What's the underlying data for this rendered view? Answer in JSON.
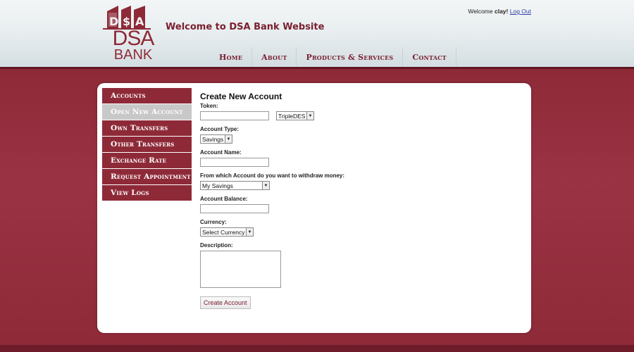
{
  "header": {
    "logo_top": "DSA",
    "logo_dsa": "DSA",
    "logo_bank": "BANK",
    "site_title": "Welcome to DSA Bank Website",
    "welcome_prefix": "Welcome",
    "username": "clay",
    "welcome_suffix": "!",
    "logout_label": "Log Out"
  },
  "topnav": {
    "items": [
      {
        "label": "Home"
      },
      {
        "label": "About"
      },
      {
        "label": "Products & Services"
      },
      {
        "label": "Contact"
      }
    ]
  },
  "sidebar": {
    "items": [
      {
        "label": "Accounts"
      },
      {
        "label": "Open New Account",
        "active": true
      },
      {
        "label": "Own Transfers"
      },
      {
        "label": "Other Transfers"
      },
      {
        "label": "Exchange Rate"
      },
      {
        "label": "Request Appointment"
      },
      {
        "label": "View Logs"
      }
    ]
  },
  "form": {
    "title": "Create New Account",
    "token_label": "Token:",
    "token_value": "",
    "token_method": "TripleDES",
    "account_type_label": "Account Type:",
    "account_type_value": "Savings",
    "account_name_label": "Account Name:",
    "account_name_value": "",
    "withdraw_label": "From which Account do you want to withdraw money:",
    "withdraw_value": "My Savings",
    "balance_label": "Account Balance:",
    "balance_value": "",
    "currency_label": "Currency:",
    "currency_value": "Select Currency",
    "description_label": "Description:",
    "description_value": "",
    "submit_label": "Create Account"
  },
  "colors": {
    "brand": "#8e2a38",
    "active_nav": "#c8c8c8",
    "link": "#3344aa"
  },
  "icons": {
    "dropdown": "chevron-down-icon"
  }
}
